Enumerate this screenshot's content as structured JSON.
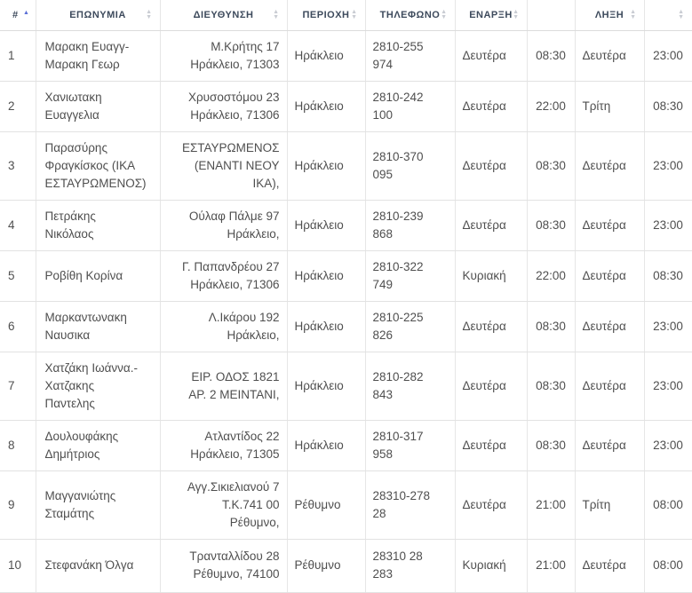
{
  "headers": [
    {
      "label": "#",
      "sort": "asc"
    },
    {
      "label": "ΕΠΩΝΥΜΙΑ",
      "sort": "none"
    },
    {
      "label": "ΔΙΕΥΘΥΝΣΗ",
      "sort": "none"
    },
    {
      "label": "ΠΕΡΙΟΧΗ",
      "sort": "none"
    },
    {
      "label": "ΤΗΛΕΦΩΝΟ",
      "sort": "none"
    },
    {
      "label": "ΕΝΑΡΞΗ",
      "sort": "none"
    },
    {
      "label": "",
      "sort": "none"
    },
    {
      "label": "ΛΗΞΗ",
      "sort": "none"
    },
    {
      "label": "",
      "sort": "none"
    }
  ],
  "rows": [
    {
      "num": "1",
      "name": [
        "Μαρακη Ευαγγ-",
        "Μαρακη Γεωρ"
      ],
      "address": [
        "Μ.Κρήτης 17",
        "Ηράκλειο, 71303"
      ],
      "area": "Ηράκλειο",
      "phone": [
        "2810-255",
        "974"
      ],
      "start_day": "Δευτέρα",
      "start_time": "08:30",
      "end_day": "Δευτέρα",
      "end_time": "23:00"
    },
    {
      "num": "2",
      "name": [
        "Χανιωτακη",
        "Ευαγγελια"
      ],
      "address": [
        "Χρυσοστόμου 23",
        "Ηράκλειο, 71306"
      ],
      "area": "Ηράκλειο",
      "phone": [
        "2810-242",
        "100"
      ],
      "start_day": "Δευτέρα",
      "start_time": "22:00",
      "end_day": "Τρίτη",
      "end_time": "08:30"
    },
    {
      "num": "3",
      "name": [
        "Παρασύρης",
        "Φραγκίσκος (ΙΚΑ",
        "ΕΣΤΑΥΡΩΜΕΝΟΣ)"
      ],
      "address": [
        "ΕΣΤΑΥΡΩΜΕΝΟΣ",
        "(ΕΝΑΝΤΙ ΝΕΟΥ",
        "ΙΚΑ),"
      ],
      "area": "Ηράκλειο",
      "phone": [
        "2810-370",
        "095"
      ],
      "start_day": "Δευτέρα",
      "start_time": "08:30",
      "end_day": "Δευτέρα",
      "end_time": "23:00"
    },
    {
      "num": "4",
      "name": [
        "Πετράκης",
        "Νικόλαος"
      ],
      "address": [
        "Ούλαφ Πάλμε 97",
        "Ηράκλειο,"
      ],
      "area": "Ηράκλειο",
      "phone": [
        "2810-239",
        "868"
      ],
      "start_day": "Δευτέρα",
      "start_time": "08:30",
      "end_day": "Δευτέρα",
      "end_time": "23:00"
    },
    {
      "num": "5",
      "name": [
        "Ροβίθη Κορίνα"
      ],
      "address": [
        "Γ. Παπανδρέου 27",
        "Ηράκλειο, 71306"
      ],
      "area": "Ηράκλειο",
      "phone": [
        "2810-322",
        "749"
      ],
      "start_day": "Κυριακή",
      "start_time": "22:00",
      "end_day": "Δευτέρα",
      "end_time": "08:30"
    },
    {
      "num": "6",
      "name": [
        "Μαρκαντωνακη",
        "Ναυσικα"
      ],
      "address": [
        "Λ.Ικάρου 192",
        "Ηράκλειο,"
      ],
      "area": "Ηράκλειο",
      "phone": [
        "2810-225",
        "826"
      ],
      "start_day": "Δευτέρα",
      "start_time": "08:30",
      "end_day": "Δευτέρα",
      "end_time": "23:00"
    },
    {
      "num": "7",
      "name": [
        "Χατζάκη Ιωάννα.-",
        "Χατζακης",
        "Παντελης"
      ],
      "address": [
        "ΕΙΡ. ΟΔΟΣ 1821",
        "ΑΡ. 2 ΜΕΙΝΤΑΝΙ,"
      ],
      "area": "Ηράκλειο",
      "phone": [
        "2810-282",
        "843"
      ],
      "start_day": "Δευτέρα",
      "start_time": "08:30",
      "end_day": "Δευτέρα",
      "end_time": "23:00"
    },
    {
      "num": "8",
      "name": [
        "Δουλουφάκης",
        "Δημήτριος"
      ],
      "address": [
        "Ατλαντίδος 22",
        "Ηράκλειο, 71305"
      ],
      "area": "Ηράκλειο",
      "phone": [
        "2810-317",
        "958"
      ],
      "start_day": "Δευτέρα",
      "start_time": "08:30",
      "end_day": "Δευτέρα",
      "end_time": "23:00"
    },
    {
      "num": "9",
      "name": [
        "Μαγγανιώτης",
        "Σταμάτης"
      ],
      "address": [
        "Αγγ.Σικιελιανού 7",
        "Τ.Κ.741 00",
        "Ρέθυμνο,"
      ],
      "area": "Ρέθυμνο",
      "phone": [
        "28310-278",
        "28"
      ],
      "start_day": "Δευτέρα",
      "start_time": "21:00",
      "end_day": "Τρίτη",
      "end_time": "08:00"
    },
    {
      "num": "10",
      "name": [
        "Στεφανάκη Όλγα"
      ],
      "address": [
        "Τρανταλλίδου 28",
        "Ρέθυμνο, 74100"
      ],
      "area": "Ρέθυμνο",
      "phone": [
        "28310 28",
        "283"
      ],
      "start_day": "Κυριακή",
      "start_time": "21:00",
      "end_day": "Δευτέρα",
      "end_time": "08:00"
    }
  ]
}
